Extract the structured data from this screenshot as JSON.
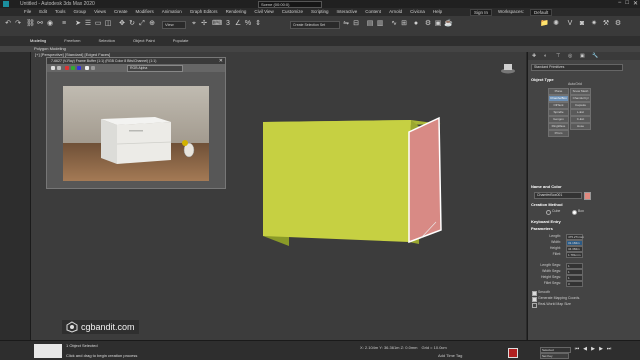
{
  "window": {
    "title": "Untitled - Autodesk 3ds Max 2020",
    "center_field": "Scene (00:00:0)",
    "minimize": "−",
    "maximize": "□",
    "close": "✕"
  },
  "menu": {
    "items": [
      "File",
      "Edit",
      "Tools",
      "Group",
      "Views",
      "Create",
      "Modifiers",
      "Animation",
      "Graph Editors",
      "Rendering",
      "Civil View",
      "Customize",
      "Scripting",
      "Interactive",
      "Content",
      "Arnold",
      "Civicna",
      "Help"
    ],
    "signin": "Sign In",
    "workspaces_label": "Workspaces:",
    "workspace_value": "Default"
  },
  "toolbar": {
    "selection_filter": "Create Selection Set",
    "view_drop": "View"
  },
  "ribbon": {
    "tabs": [
      "Modeling",
      "Freeform",
      "Selection",
      "Object Paint",
      "Populate"
    ],
    "active_tab": "Modeling",
    "subtab": "Polygon Modeling"
  },
  "viewport": {
    "label": "[+] [Perspective] [Standard] [Edged Faces]",
    "colors": {
      "box_front": "#c6d042",
      "box_top": "#a9b636",
      "box_side": "#8a9a28",
      "panel": "#d88a85"
    }
  },
  "frame_window": {
    "title": "7-6627 (V-Ray) Frame Buffer (1:1) (RGB Color 8 Bits/Channel) (1:1)",
    "channel": "RGB Alpha",
    "close": "✕"
  },
  "command_panel": {
    "dropdown": "Standard Primitives",
    "object_type_header": "Object Type",
    "autogrid": "AutoGrid",
    "object_buttons": [
      "Plane",
      "Snow Mesh",
      "ChamferBox",
      "ChamferCyl",
      "OilTank",
      "Capsule",
      "Spindle",
      "L-Ext",
      "Gengon",
      "C-Ext",
      "RingWave",
      "Hose",
      "Prism"
    ],
    "active_object": "ChamferBox",
    "name_color_header": "Name and Color",
    "object_name": "ChamferBox001",
    "color": "#e1897f",
    "creation_method_header": "Creation Method",
    "creation_options": [
      "Cube",
      "Box"
    ],
    "creation_selected": "Box",
    "keyboard_header": "Keyboard Entry",
    "parameters_header": "Parameters",
    "params": [
      {
        "label": "Length:",
        "value": "475.271mm"
      },
      {
        "label": "Width:",
        "value": "31.184m"
      },
      {
        "label": "Height:",
        "value": "34.384m"
      },
      {
        "label": "Fillet:",
        "value": "1.781mm"
      }
    ],
    "selected_param": "Width:",
    "segs": [
      {
        "label": "Length Segs:",
        "value": "1"
      },
      {
        "label": "Width Segs:",
        "value": "1"
      },
      {
        "label": "Height Segs:",
        "value": "1"
      },
      {
        "label": "Fillet Segs:",
        "value": "3"
      }
    ],
    "checks": [
      "Smooth",
      "Generate Mapping Coords.",
      "Real-World Map Size"
    ]
  },
  "status": {
    "objects_selected": "1 Object Selected",
    "prompt": "Click and drag to begin creation process",
    "coords": "X: 2.104m  Y: 36.361m  Z: 0.0mm",
    "grid": "Grid = 10.0cm",
    "add_time_tag": "Add Time Tag",
    "selected_drop": "Selected",
    "set_key": "Set Key"
  },
  "logo": {
    "text": "cgbandit.com"
  }
}
